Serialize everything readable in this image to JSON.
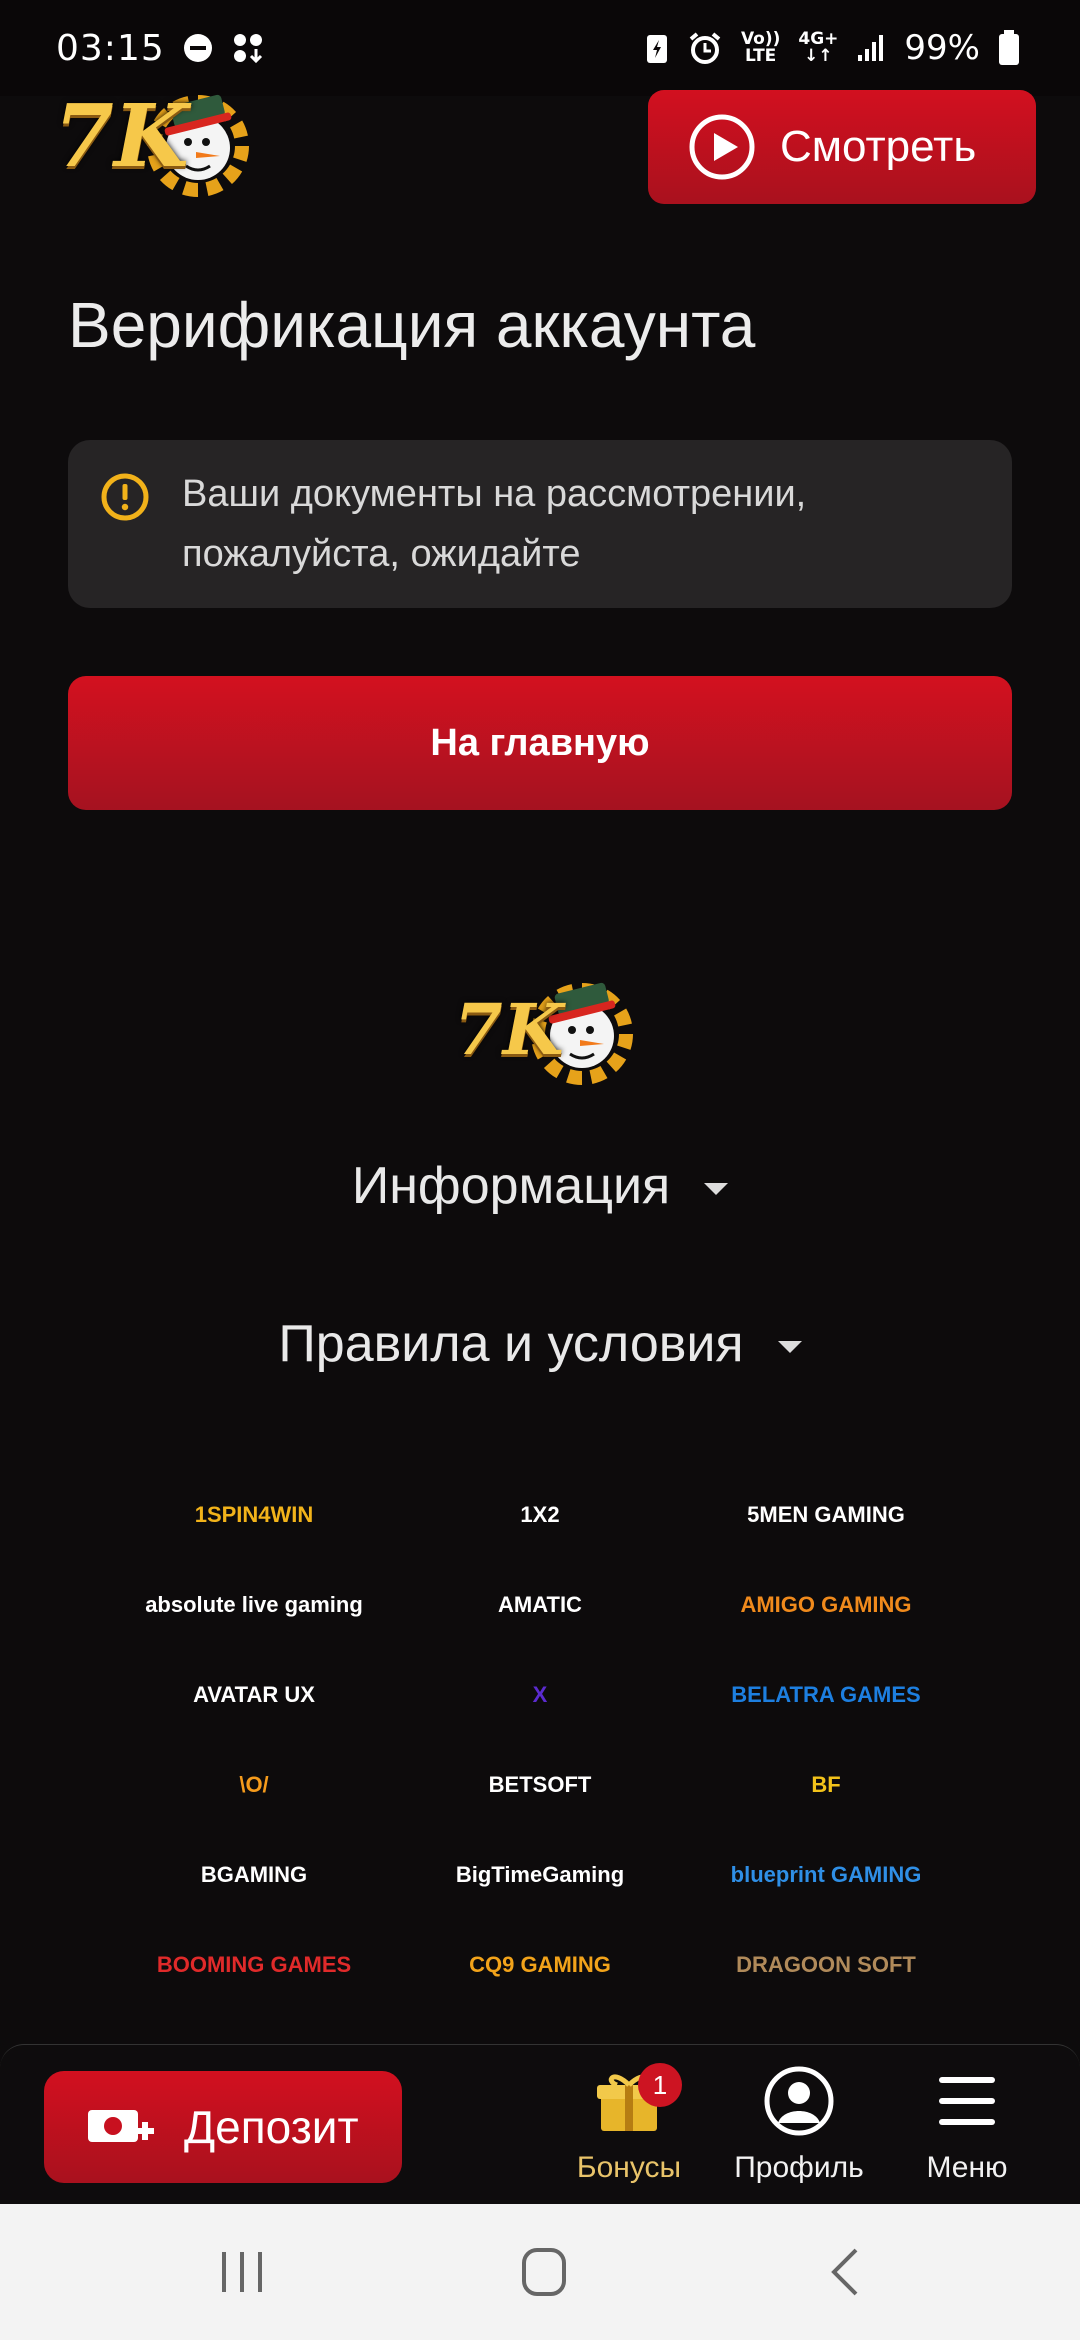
{
  "status_bar": {
    "time": "03:15",
    "volte_top": "Vo))",
    "volte_bottom": "LTE",
    "net_top": "4G+",
    "net_bottom": "↓↑",
    "battery": "99%"
  },
  "header": {
    "logo_text": "7K",
    "watch_label": "Смотреть"
  },
  "main": {
    "title": "Верификация аккаунта",
    "notice_line1": "Ваши документы на рассмотрении,",
    "notice_line2": "пожалуйста, ожидайте",
    "home_button": "На главную"
  },
  "footer": {
    "logo_text": "7K",
    "info": "Информация",
    "rules": "Правила и условия"
  },
  "providers": [
    {
      "name": "1SPIN4WIN",
      "color": "#f2b31a"
    },
    {
      "name": "1X2",
      "color": "#ffffff"
    },
    {
      "name": "5MEN GAMING",
      "color": "#ffffff"
    },
    {
      "name": "absolute live gaming",
      "color": "#ffffff"
    },
    {
      "name": "AMATIC",
      "color": "#ffffff"
    },
    {
      "name": "AMIGO GAMING",
      "color": "#f08a1c"
    },
    {
      "name": "AVATAR UX",
      "color": "#ffffff"
    },
    {
      "name": "X",
      "color": "#5b2bd0"
    },
    {
      "name": "BELATRA GAMES",
      "color": "#1d7fe0"
    },
    {
      "name": "\\O/",
      "color": "#f59b1c"
    },
    {
      "name": "BETSOFT",
      "color": "#ffffff"
    },
    {
      "name": "BF",
      "color": "#f2c21a"
    },
    {
      "name": "BGAMING",
      "color": "#ffffff"
    },
    {
      "name": "BigTimeGaming",
      "color": "#ffffff"
    },
    {
      "name": "blueprint GAMING",
      "color": "#2f8fe6"
    },
    {
      "name": "BOOMING GAMES",
      "color": "#e02a2a"
    },
    {
      "name": "CQ9 GAMING",
      "color": "#f2a31a"
    },
    {
      "name": "DRAGOON SOFT",
      "color": "#b08a5a"
    }
  ],
  "bottom_nav": {
    "deposit": "Депозит",
    "bonuses": "Бонусы",
    "bonuses_badge": "1",
    "profile": "Профиль",
    "menu": "Меню"
  },
  "colors": {
    "accent_red": "#c8101f",
    "background": "#0d0b0c",
    "notice_bg": "#262425",
    "warning_yellow": "#f2b21a"
  }
}
